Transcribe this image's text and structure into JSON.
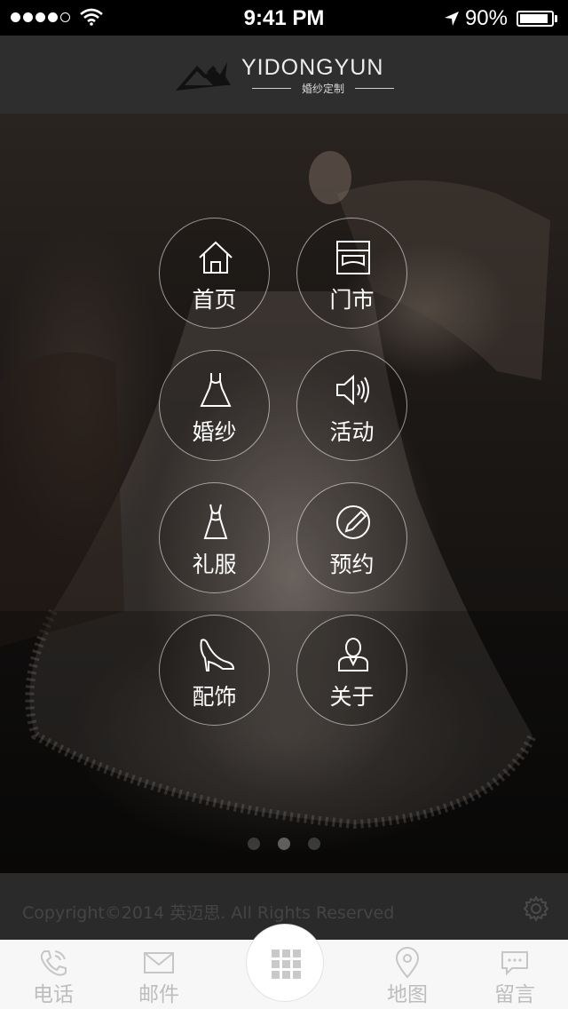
{
  "status_bar": {
    "time": "9:41 PM",
    "battery_percent": "90%",
    "battery_level": 0.9,
    "signal_dots_filled": 4,
    "signal_dots_total": 5
  },
  "header": {
    "brand": "YIDONGYUN",
    "tagline": "婚纱定制"
  },
  "menu": [
    {
      "label": "首页",
      "icon": "home-icon"
    },
    {
      "label": "门市",
      "icon": "store-icon"
    },
    {
      "label": "婚纱",
      "icon": "wedding-dress-icon"
    },
    {
      "label": "活动",
      "icon": "speaker-icon"
    },
    {
      "label": "礼服",
      "icon": "gown-icon"
    },
    {
      "label": "预约",
      "icon": "pen-circle-icon"
    },
    {
      "label": "配饰",
      "icon": "high-heel-icon"
    },
    {
      "label": "关于",
      "icon": "person-icon"
    }
  ],
  "pager": {
    "count": 3,
    "active_index": 1
  },
  "footer": {
    "copyright": "Copyright©2014 英迈思. All Rights Reserved",
    "settings_icon": "gear-icon"
  },
  "tabbar": {
    "tabs": [
      {
        "label": "电话",
        "icon": "phone-icon"
      },
      {
        "label": "邮件",
        "icon": "mail-icon"
      },
      {
        "label": "地图",
        "icon": "map-pin-icon"
      },
      {
        "label": "留言",
        "icon": "message-icon"
      }
    ],
    "center_icon": "grid-menu-icon"
  },
  "colors": {
    "header_bg": "#2e2e2e",
    "footer_bg": "#2a2a2a",
    "tabbar_bg": "#f7f7f7",
    "tab_text": "#bdbdbd"
  }
}
